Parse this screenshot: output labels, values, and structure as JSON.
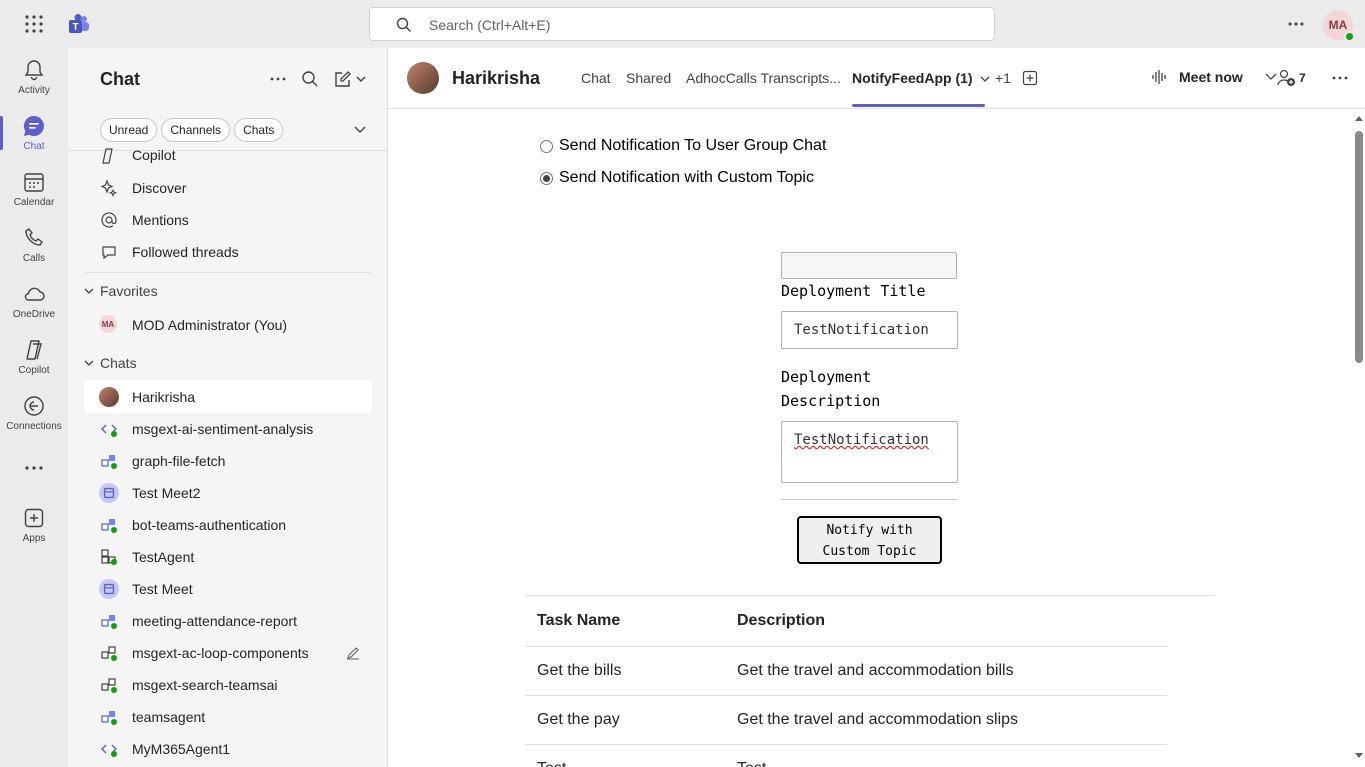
{
  "search": {
    "placeholder": "Search (Ctrl+Alt+E)"
  },
  "user": {
    "initials": "MA"
  },
  "rail": [
    {
      "label": "Activity",
      "icon": "bell-icon"
    },
    {
      "label": "Chat",
      "icon": "chat-icon"
    },
    {
      "label": "Calendar",
      "icon": "calendar-icon"
    },
    {
      "label": "Calls",
      "icon": "phone-icon"
    },
    {
      "label": "OneDrive",
      "icon": "cloud-icon"
    },
    {
      "label": "Copilot",
      "icon": "copilot-icon"
    },
    {
      "label": "Connections",
      "icon": "connections-icon"
    },
    {
      "label": "...",
      "icon": "more-icon"
    },
    {
      "label": "Apps",
      "icon": "apps-plus-icon"
    }
  ],
  "chatpane": {
    "title": "Chat",
    "filters": [
      "Unread",
      "Channels",
      "Chats"
    ],
    "top_items": [
      "Copilot",
      "Discover",
      "Mentions",
      "Followed threads"
    ],
    "favorites_label": "Favorites",
    "favorites": [
      {
        "label": "MOD Administrator (You)",
        "initials": "MA"
      }
    ],
    "chats_label": "Chats",
    "chats": [
      "Harikrisha",
      "msgext-ai-sentiment-analysis",
      "graph-file-fetch",
      "Test Meet2",
      "bot-teams-authentication",
      "TestAgent",
      "Test Meet",
      "meeting-attendance-report",
      "msgext-ac-loop-components",
      "msgext-search-teamsai",
      "teamsagent",
      "MyM365Agent1"
    ]
  },
  "header": {
    "title": "Harikrisha",
    "tabs": [
      "Chat",
      "Shared",
      "AdhocCalls Transcripts...",
      "NotifyFeedApp (1)",
      "+1"
    ],
    "meet_now": "Meet now",
    "participants": "7"
  },
  "form": {
    "radio1": "Send Notification To User Group Chat",
    "radio2": "Send Notification with Custom Topic",
    "title_label": "Deployment Title",
    "title_value": "TestNotification",
    "desc_label_1": "Deployment",
    "desc_label_2": "Description",
    "desc_value": "TestNotification",
    "button_line1": "Notify with",
    "button_line2": "Custom Topic"
  },
  "table": {
    "headers": [
      "Task Name",
      "Description"
    ],
    "rows": [
      [
        "Get the bills",
        "Get the travel and accommodation bills"
      ],
      [
        "Get the pay",
        "Get the travel and accommodation slips"
      ],
      [
        "Test",
        "Test"
      ]
    ]
  }
}
